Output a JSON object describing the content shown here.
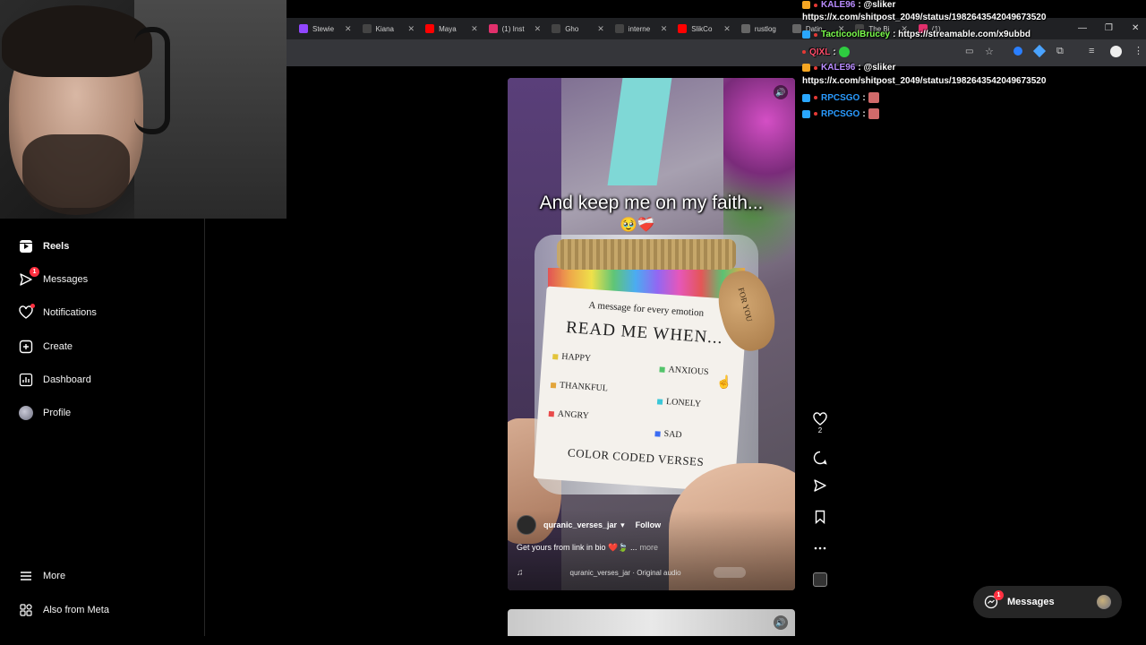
{
  "browser": {
    "tabs": [
      {
        "label": "Stewie",
        "icon": "twitch-icon",
        "color": "#9146ff"
      },
      {
        "label": "Kiana",
        "icon": "x-icon",
        "color": "#ffffff"
      },
      {
        "label": "Maya",
        "icon": "youtube-icon",
        "color": "#ff0000"
      },
      {
        "label": "(1) Inst",
        "icon": "instagram-icon",
        "color": "#e1306c"
      },
      {
        "label": "Gho",
        "icon": "x-icon",
        "color": "#ffffff"
      },
      {
        "label": "interne",
        "icon": "x-icon",
        "color": "#ffffff"
      },
      {
        "label": "SlikCo",
        "icon": "youtube-icon",
        "color": "#ff0000"
      },
      {
        "label": "rustlog",
        "icon": "page-icon",
        "color": "#888888"
      },
      {
        "label": "Datin",
        "icon": "page-icon",
        "color": "#888888"
      },
      {
        "label": "The Bi",
        "icon": "x-icon",
        "color": "#ffffff"
      },
      {
        "label": "(1)",
        "icon": "instagram-icon",
        "color": "#e1306c"
      }
    ]
  },
  "sidebar": {
    "items": [
      {
        "label": "Reels",
        "icon": "reels-icon",
        "badge": ""
      },
      {
        "label": "Messages",
        "icon": "messenger-icon",
        "badge": "1"
      },
      {
        "label": "Notifications",
        "icon": "heart-icon",
        "badge": ""
      },
      {
        "label": "Create",
        "icon": "plus-square-icon",
        "badge": ""
      },
      {
        "label": "Dashboard",
        "icon": "dashboard-icon",
        "badge": ""
      },
      {
        "label": "Profile",
        "icon": "avatar",
        "badge": ""
      }
    ],
    "bottom": [
      {
        "label": "More",
        "icon": "menu-icon"
      },
      {
        "label": "Also from Meta",
        "icon": "meta-icon"
      }
    ]
  },
  "reel": {
    "caption_overlay": "And keep me on my faith...",
    "caption_emoji": "🥹❤️‍🩹",
    "jar_label": {
      "message": "A message for every emotion",
      "title": "READ ME WHEN...",
      "emotions": [
        {
          "text": "HAPPY",
          "color": "#e3c43a"
        },
        {
          "text": "ANXIOUS",
          "color": "#53c46b"
        },
        {
          "text": "THANKFUL",
          "color": "#e3a53a"
        },
        {
          "text": "LONELY",
          "color": "#3bc7d8"
        },
        {
          "text": "ANGRY",
          "color": "#e94b4b"
        },
        {
          "text": "SAD",
          "color": "#3b6cf3"
        }
      ],
      "footer": "COLOR CODED VERSES",
      "tag": "FOR YOU"
    },
    "owner": "quranic_verses_jar",
    "follow_label": "Follow",
    "description": "Get yours from link in bio ❤️🍃 ...",
    "more_label": "more",
    "audio": "quranic_verses_jar · Original audio",
    "likes": "2"
  },
  "chat": {
    "messages": [
      {
        "user": "KALE96",
        "color": "#b98cff",
        "text": "@sliker",
        "badge_color": "#f5a623"
      },
      {
        "user": "",
        "color": "#ffffff",
        "text": "https://x.com/shitpost_2049/status/1982643542049673520",
        "badge_color": ""
      },
      {
        "user": "TacticoolBrucey",
        "color": "#7cff4d",
        "text": "https://streamable.com/x9ubbd",
        "badge_color": "#2aa7ff"
      },
      {
        "user": "QIXL",
        "color": "#ff4d6a",
        "text": "",
        "badge_color": "",
        "emote": "#2ecc40"
      },
      {
        "user": "KALE96",
        "color": "#b98cff",
        "text": "@sliker",
        "badge_color": "#f5a623"
      },
      {
        "user": "",
        "color": "#ffffff",
        "text": "https://x.com/shitpost_2049/status/1982643542049673520",
        "badge_color": ""
      },
      {
        "user": "RPCSGO",
        "color": "#2a9bff",
        "text": "",
        "badge_color": "#2aa7ff",
        "emote": "#d06a6a"
      },
      {
        "user": "RPCSGO",
        "color": "#2a9bff",
        "text": "",
        "badge_color": "#2aa7ff",
        "emote": "#d06a6a"
      }
    ]
  },
  "messages_pill": {
    "label": "Messages",
    "badge": "1"
  }
}
